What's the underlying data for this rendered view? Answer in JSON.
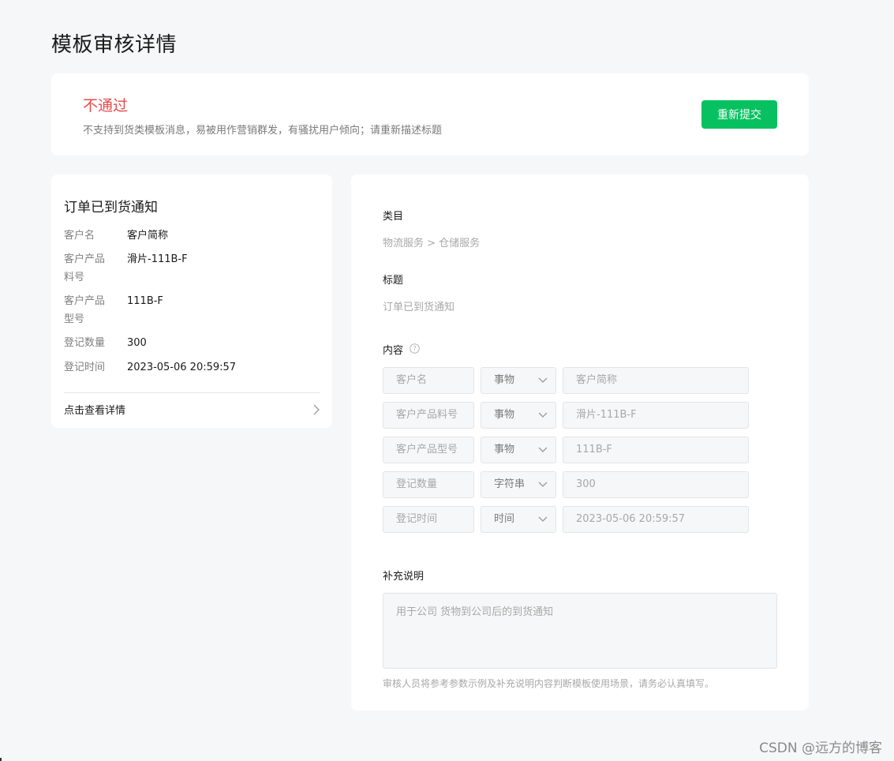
{
  "page": {
    "title": "模板审核详情"
  },
  "status": {
    "title": "不通过",
    "description": "不支持到货类模板消息，易被用作营销群发，有骚扰用户倾向；请重新描述标题",
    "resubmit_label": "重新提交",
    "status_color": "#e84a4a",
    "button_color": "#07c160"
  },
  "preview": {
    "title": "订单已到货通知",
    "fields": [
      {
        "label": "客户名",
        "value": "客户简称"
      },
      {
        "label": "客户产品料号",
        "value": "滑片-111B-F"
      },
      {
        "label": "客户产品型号",
        "value": "111B-F"
      },
      {
        "label": "登记数量",
        "value": "300"
      },
      {
        "label": "登记时间",
        "value": "2023-05-06 20:59:57"
      }
    ],
    "detail_link": "点击查看详情",
    "detail_icon": "chevron-right-icon"
  },
  "form": {
    "category_label": "类目",
    "category_value": "物流服务 > 仓储服务",
    "title_label": "标题",
    "title_value": "订单已到货通知",
    "content_label": "内容",
    "content_help_icon": "question-circle-icon",
    "variables": [
      {
        "name": "客户名",
        "type": "事物",
        "sample": "客户简称"
      },
      {
        "name": "客户产品料号",
        "type": "事物",
        "sample": "滑片-111B-F"
      },
      {
        "name": "客户产品型号",
        "type": "事物",
        "sample": "111B-F"
      },
      {
        "name": "登记数量",
        "type": "字符串",
        "sample": "300"
      },
      {
        "name": "登记时间",
        "type": "时间",
        "sample": "2023-05-06 20:59:57"
      }
    ],
    "note_label": "补充说明",
    "note_value": "用于公司 货物到公司后的到货通知",
    "note_hint": "审核人员将参考参数示例及补充说明内容判断模板使用场景，请务必认真填写。"
  },
  "watermark": "CSDN @远方的博客"
}
